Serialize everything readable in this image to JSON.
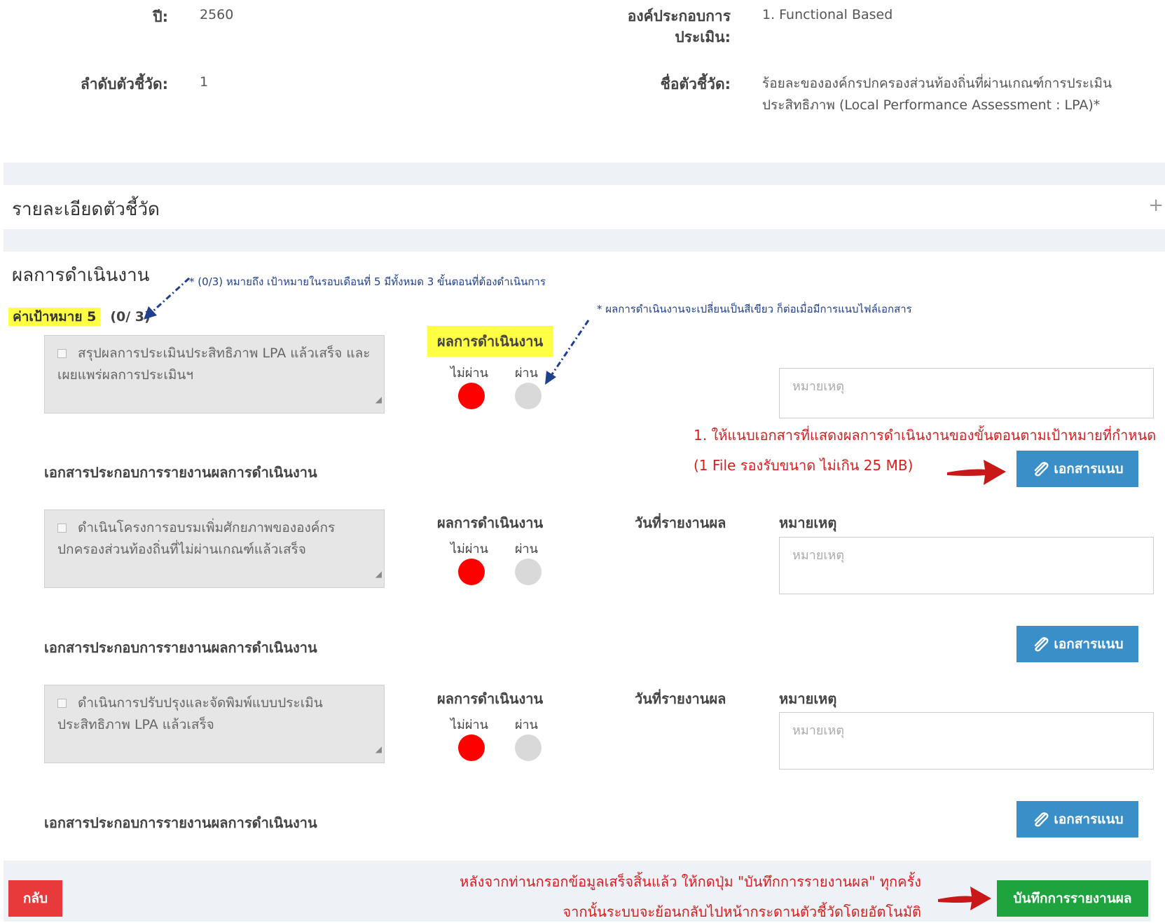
{
  "header": {
    "year_label": "ปี:",
    "year_value": "2560",
    "component_label": "องค์ประกอบการประเมิน:",
    "component_value": "1. Functional Based",
    "indicator_no_label": "ลำดับตัวชี้วัด:",
    "indicator_no_value": "1",
    "indicator_name_label": "ชื่อตัวชี้วัด:",
    "indicator_name_value": "ร้อยละขององค์กรปกครองส่วนท้องถิ่นที่ผ่านเกณฑ์การประเมินประสิทธิภาพ (Local Performance Assessment : LPA)*"
  },
  "detail_panel": {
    "title": "รายละเอียดตัวชี้วัด",
    "expand_icon": "plus-icon"
  },
  "results_panel": {
    "title": "ผลการดำเนินงาน",
    "target_label": "ค่าเป้าหมาย 5",
    "target_count": "(0/ 3)",
    "annotation_target": "* (0/3) หมายถึง เป้าหมายในรอบเดือนที่ 5 มีทั้งหมด 3 ขั้นตอนที่ต้องดำเนินการ",
    "annotation_green": "* ผลการดำเนินงานจะเปลี่ยนเป็นสีเขียว ก็ต่อเมื่อมีการแนบไฟล์เอกสาร",
    "annotation_attach_1": "1. ให้แนบเอกสารที่แสดงผลการดำเนินงานของขั้นตอนตามเป้าหมายที่กำหนด",
    "annotation_attach_2": "(1 File รองรับขนาด ไม่เกิน 25 MB)",
    "result_header": "ผลการดำเนินงาน",
    "date_header": "วันที่รายงานผล",
    "remark_header": "หมายเหตุ",
    "fail_label": "ไม่ผ่าน",
    "pass_label": "ผ่าน",
    "remark_placeholder": "หมายเหตุ",
    "doc_label": "เอกสารประกอบการรายงานผลการดำเนินงาน",
    "attach_button": "เอกสารแนบ",
    "steps": [
      {
        "text": "สรุปผลการประเมินประสิทธิภาพ LPA แล้วเสร็จ และเผยแพร่ผลการประเมินฯ"
      },
      {
        "text": "ดำเนินโครงการอบรมเพิ่มศักยภาพขององค์กรปกครองส่วนท้องถิ่นที่ไม่ผ่านเกณฑ์แล้วเสร็จ"
      },
      {
        "text": "ดำเนินการปรับปรุงและจัดพิมพ์แบบประเมินประสิทธิภาพ LPA แล้วเสร็จ"
      }
    ]
  },
  "footer": {
    "back_button": "กลับ",
    "save_button": "บันทึกการรายงานผล",
    "annotation_1": "หลังจากท่านกรอกข้อมูลเสร็จสิ้นแล้ว ให้กดปุ่ม \"บันทึกการรายงานผล\" ทุกครั้ง",
    "annotation_2": "จากนั้นระบบจะย้อนกลับไปหน้ากระดานตัวชี้วัดโดยอัตโนมัติ"
  },
  "colors": {
    "fail_dot": "#ff0000",
    "pass_dot": "#d9d9d9",
    "attach_button": "#3a8fc8",
    "save_button": "#1fa33f",
    "back_button": "#e83a3a",
    "highlight": "#ffff44"
  }
}
